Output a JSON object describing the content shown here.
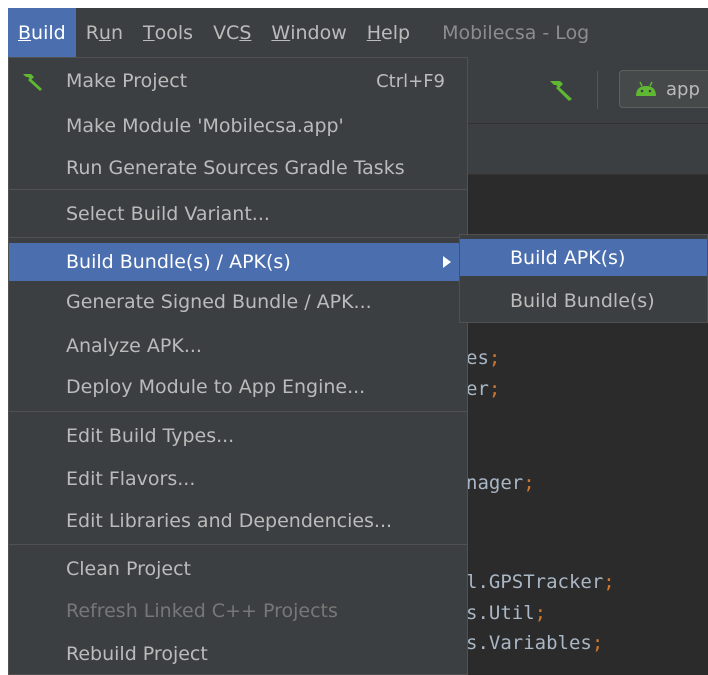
{
  "menubar": {
    "items": [
      {
        "label": "Build",
        "active": true
      },
      {
        "label": "Run"
      },
      {
        "label": "Tools"
      },
      {
        "label": "VCS"
      },
      {
        "label": "Window"
      },
      {
        "label": "Help"
      }
    ],
    "window_title": "Mobilecsa - Log"
  },
  "toolbar": {
    "run_config": "app"
  },
  "build_menu": {
    "items": [
      {
        "label": "Make Project",
        "shortcut": "Ctrl+F9",
        "icon": "hammer-icon"
      },
      {
        "label": "Make Module 'Mobilecsa.app'"
      },
      {
        "label": "Run Generate Sources Gradle Tasks"
      },
      {
        "label": "Select Build Variant..."
      },
      {
        "label": "Build Bundle(s) / APK(s)",
        "selected": true,
        "has_submenu": true
      },
      {
        "label": "Generate Signed Bundle / APK..."
      },
      {
        "label": "Analyze APK..."
      },
      {
        "label": "Deploy Module to App Engine..."
      },
      {
        "label": "Edit Build Types..."
      },
      {
        "label": "Edit Flavors..."
      },
      {
        "label": "Edit Libraries and Dependencies..."
      },
      {
        "label": "Clean Project"
      },
      {
        "label": "Refresh Linked C++ Projects",
        "disabled": true
      },
      {
        "label": "Rebuild Project"
      }
    ]
  },
  "submenu": {
    "items": [
      {
        "label": "Build APK(s)",
        "selected": true
      },
      {
        "label": "Build Bundle(s)"
      }
    ]
  },
  "editor": {
    "lines": [
      {
        "text": "es",
        "semi": ";"
      },
      {
        "text": "er",
        "semi": ";"
      },
      {
        "text": "nager",
        "semi": ";"
      },
      {
        "text": "l.GPSTracker",
        "semi": ";"
      },
      {
        "text": "s.Util",
        "semi": ";"
      },
      {
        "text": "s.Variables",
        "semi": ";"
      }
    ]
  },
  "colors": {
    "menu_bg": "#3c3f41",
    "selection": "#4b6eaf",
    "editor_bg": "#2b2b2b",
    "text": "#bbbbbb",
    "keyword": "#cc7832",
    "build_icon_green": "#5fb832"
  }
}
